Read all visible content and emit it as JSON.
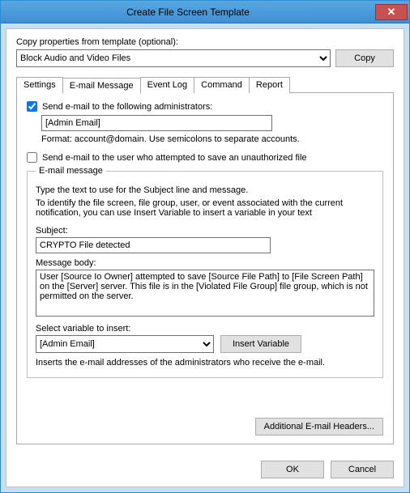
{
  "window": {
    "title": "Create File Screen Template"
  },
  "copy": {
    "label": "Copy properties from template (optional):",
    "selected": "Block Audio and Video Files",
    "copy_button": "Copy"
  },
  "tabs": {
    "settings": "Settings",
    "email": "E-mail Message",
    "eventlog": "Event Log",
    "command": "Command",
    "report": "Report"
  },
  "email": {
    "admin_checkbox_label": "Send e-mail to the following administrators:",
    "admin_value": "[Admin Email]",
    "format_note": "Format: account@domain. Use semicolons to separate accounts.",
    "user_checkbox_label": "Send e-mail to the user who attempted to save an unauthorized file",
    "message_group": "E-mail message",
    "message_instruction": "Type the text to use for the Subject line and message.",
    "message_hint": "To identify the file screen, file group, user, or event associated with the current notification, you can use Insert Variable to insert a variable in your text",
    "subject_label": "Subject:",
    "subject_value": "CRYPTO File detected",
    "body_label": "Message body:",
    "body_value": "User [Source Io Owner] attempted to save [Source File Path] to [File Screen Path] on the [Server] server. This file is in the [Violated File Group] file group, which is not permitted on the server.",
    "variable_label": "Select variable to insert:",
    "variable_selected": "[Admin Email]",
    "insert_variable_button": "Insert Variable",
    "variable_desc": "Inserts the e-mail addresses of the administrators who receive the e-mail.",
    "additional_headers_button": "Additional E-mail Headers..."
  },
  "buttons": {
    "ok": "OK",
    "cancel": "Cancel"
  }
}
